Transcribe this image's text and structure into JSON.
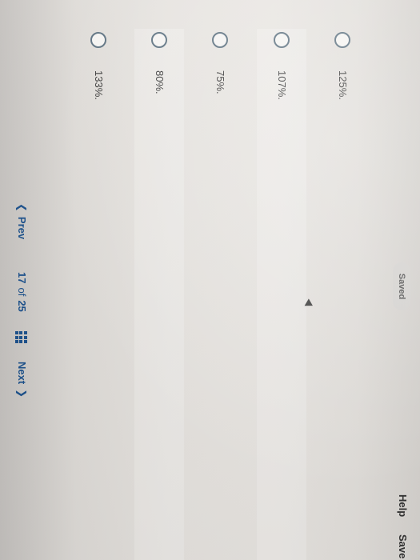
{
  "header": {
    "saved_label": "Saved",
    "help_label": "Help",
    "save_label": "Save"
  },
  "options": [
    {
      "label": "125%."
    },
    {
      "label": "107%."
    },
    {
      "label": "75%."
    },
    {
      "label": "80%."
    },
    {
      "label": "133%."
    }
  ],
  "footer": {
    "prev_label": "Prev",
    "page_current": "17",
    "page_of": "of",
    "page_total": "25",
    "next_label": "Next"
  },
  "colors": {
    "link": "#1a4f8a",
    "radio_border": "#5a6f7e"
  },
  "icons": {
    "prev": "chevron-left-icon",
    "next": "chevron-right-icon",
    "grid": "grid-icon"
  }
}
